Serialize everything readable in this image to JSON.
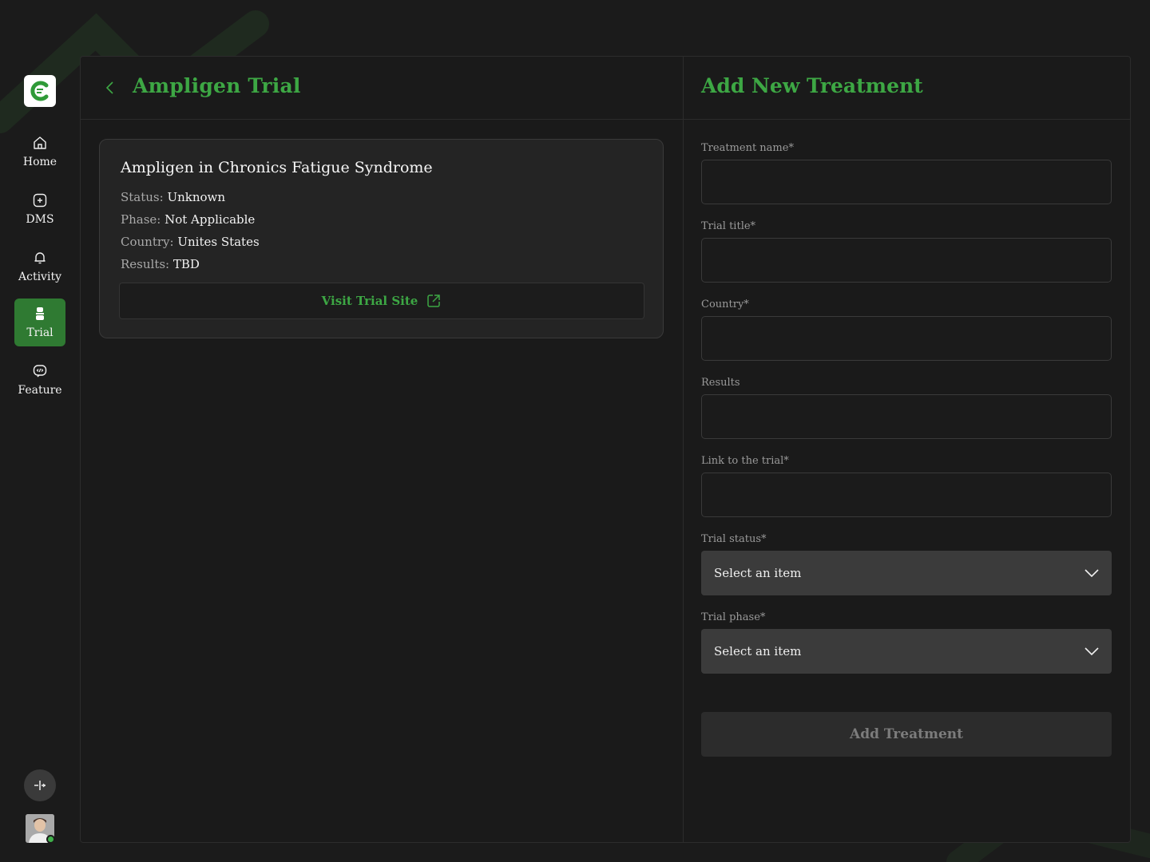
{
  "sidebar": {
    "items": [
      {
        "label": "Home",
        "icon": "home-icon"
      },
      {
        "label": "DMS",
        "icon": "plus-square-icon"
      },
      {
        "label": "Activity",
        "icon": "bell-icon"
      },
      {
        "label": "Trial",
        "icon": "flask-icon",
        "active": true
      },
      {
        "label": "Feature",
        "icon": "code-bubble-icon"
      }
    ]
  },
  "left": {
    "title": "Ampligen Trial",
    "card": {
      "title": "Ampligen in Chronics Fatigue Syndrome",
      "status_label": "Status:",
      "status_value": "Unknown",
      "phase_label": "Phase:",
      "phase_value": "Not Applicable",
      "country_label": "Country:",
      "country_value": "Unites States",
      "results_label": "Results:",
      "results_value": "TBD",
      "visit_label": "Visit Trial Site"
    }
  },
  "right": {
    "title": "Add New Treatment",
    "fields": {
      "treatment_name": {
        "label": "Treatment name*",
        "value": ""
      },
      "trial_title": {
        "label": "Trial title*",
        "value": ""
      },
      "country": {
        "label": "Country*",
        "value": ""
      },
      "results": {
        "label": "Results",
        "value": ""
      },
      "link": {
        "label": "Link to the trial*",
        "value": ""
      }
    },
    "trial_status": {
      "label": "Trial status*",
      "selected": "Select an item"
    },
    "trial_phase": {
      "label": "Trial phase*",
      "selected": "Select an item"
    },
    "submit_label": "Add Treatment"
  },
  "colors": {
    "accent": "#3da744",
    "active_nav": "#2f7a32",
    "online": "#3fb04a"
  }
}
